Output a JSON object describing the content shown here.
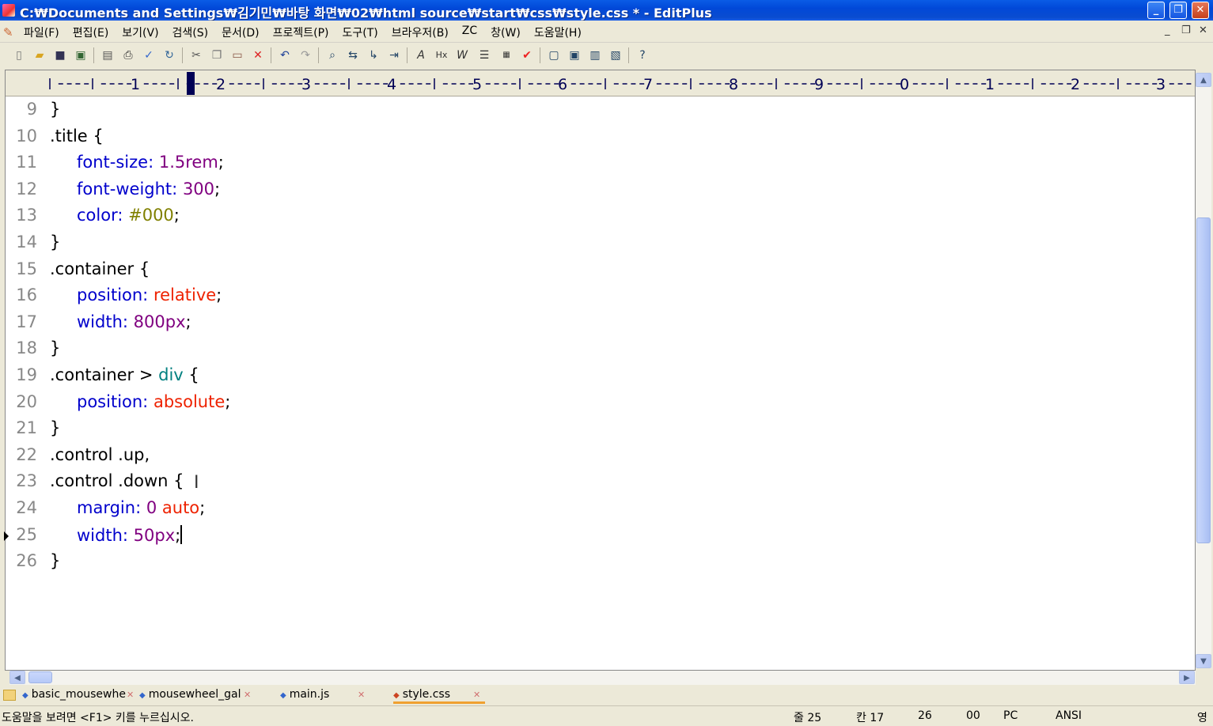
{
  "window": {
    "title": "C:₩Documents and Settings₩김기민₩바탕 화면₩02₩html source₩start₩css₩style.css * - EditPlus",
    "buttons": {
      "minimize": "_",
      "restore": "❐",
      "close": "✕"
    }
  },
  "menu": {
    "items": [
      "파일(F)",
      "편집(E)",
      "보기(V)",
      "검색(S)",
      "문서(D)",
      "프로젝트(P)",
      "도구(T)",
      "브라우저(B)",
      "ZC",
      "창(W)",
      "도움말(H)"
    ],
    "mdi": {
      "minimize": "_",
      "restore": "❐",
      "close": "✕"
    }
  },
  "toolbar": {
    "icons": [
      "new-file-icon",
      "open-icon",
      "save-icon",
      "save-all-icon",
      "print-preview-icon",
      "print-icon",
      "spellcheck-icon",
      "refresh-icon",
      "cut-icon",
      "copy-icon",
      "paste-icon",
      "delete-icon",
      "undo-icon",
      "redo-icon",
      "find-icon",
      "replace-icon",
      "goto-icon",
      "indent-icon",
      "font-icon",
      "hex-icon",
      "wordwrap-icon",
      "list-icon",
      "ruler-icon",
      "check-icon",
      "window-icon",
      "cliptext-icon",
      "directory-icon",
      "output-icon",
      "help-icon"
    ]
  },
  "ruler": {
    "labels": [
      "1",
      "2",
      "3",
      "4",
      "5",
      "6",
      "7",
      "8",
      "9",
      "0",
      "1",
      "2",
      "3"
    ]
  },
  "code": {
    "lines": [
      {
        "n": "9"
      },
      {
        "n": "10"
      },
      {
        "n": "11"
      },
      {
        "n": "12"
      },
      {
        "n": "13"
      },
      {
        "n": "14"
      },
      {
        "n": "15"
      },
      {
        "n": "16"
      },
      {
        "n": "17"
      },
      {
        "n": "18"
      },
      {
        "n": "19"
      },
      {
        "n": "20"
      },
      {
        "n": "21"
      },
      {
        "n": "22"
      },
      {
        "n": "23"
      },
      {
        "n": "24"
      },
      {
        "n": "25"
      },
      {
        "n": "26"
      }
    ],
    "text": {
      "l9": "}",
      "l10": ".title {",
      "l11_prop": "font-size:",
      "l11_val": "1.5rem",
      "l11_end": ";",
      "l12_prop": "font-weight:",
      "l12_val": "300",
      "l12_end": ";",
      "l13_prop": "color:",
      "l13_val": "#000",
      "l13_end": ";",
      "l14": "}",
      "l15": ".container {",
      "l16_prop": "position:",
      "l16_val": "relative",
      "l16_end": ";",
      "l17_prop": "width:",
      "l17_val": "800px",
      "l17_end": ";",
      "l18": "}",
      "l19_sel": ".container > ",
      "l19_tag": "div",
      "l19_end": " {",
      "l20_prop": "position:",
      "l20_val": "absolute",
      "l20_end": ";",
      "l21": "}",
      "l22": ".control .up,",
      "l23": ".control .down {",
      "l24_prop": "margin:",
      "l24_num": "0",
      "l24_kw": "auto",
      "l24_end": ";",
      "l25_prop": "width:",
      "l25_val": "50px",
      "l25_end": ";",
      "l26": "}"
    }
  },
  "tabs": [
    {
      "label": "basic_mousewhe"
    },
    {
      "label": "mousewheel_gal"
    },
    {
      "label": "main.js"
    },
    {
      "label": "style.css"
    }
  ],
  "status": {
    "help": "도움말을 보려면 <F1> 키를 누르십시오.",
    "line": "줄 25",
    "col": "칸 17",
    "total": "26",
    "code": "00",
    "mode": "PC",
    "encoding": "ANSI",
    "ime": "영"
  },
  "colors": {
    "property": "#0000cc",
    "number": "#800080",
    "keyword": "#ee2200",
    "hex": "#808000",
    "tag": "#008080",
    "titlebar": "#0148d8"
  }
}
